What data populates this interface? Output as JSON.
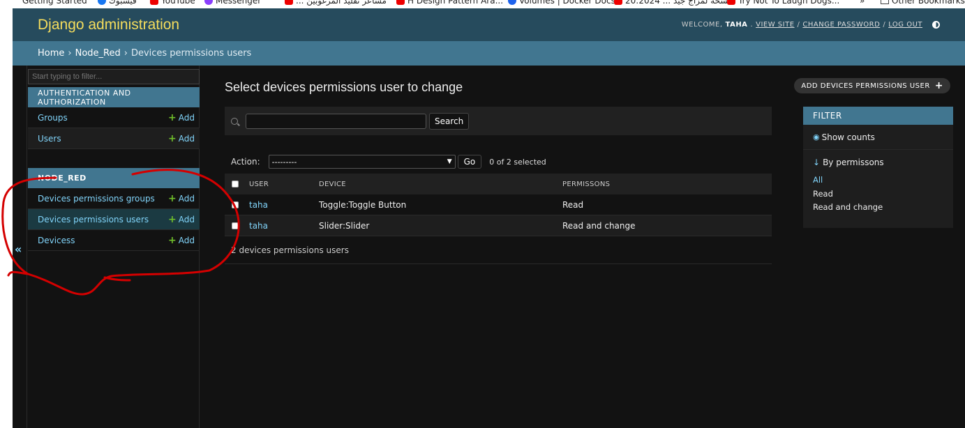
{
  "bookmarks": [
    {
      "label": "Getting Started",
      "icon": "firefox-icon"
    },
    {
      "label": "فيسبوك",
      "icon": "facebook-icon"
    },
    {
      "label": "YouTube",
      "icon": "youtube-icon"
    },
    {
      "label": "Messenger",
      "icon": "messenger-icon"
    },
    {
      "label": "... مشاعر تقليد المرغوبين",
      "icon": "youtube-icon"
    },
    {
      "label": "H Design Pattern Ara...",
      "icon": "youtube-icon"
    },
    {
      "label": "Volumes | Docker Docs",
      "icon": "docker-icon"
    },
    {
      "label": "20:2024 ... نسخة لمزاج جيد",
      "icon": "youtube-icon"
    },
    {
      "label": "Try Not To Laugh Dogs...",
      "icon": "youtube-icon"
    },
    {
      "label": "»",
      "icon": ""
    },
    {
      "label": "Other Bookmarks",
      "icon": "folder-icon"
    }
  ],
  "header": {
    "brand": "Django administration",
    "welcome": "WELCOME,",
    "username": "TAHA",
    "view_site": "VIEW SITE",
    "change_password": "CHANGE PASSWORD",
    "log_out": "LOG OUT",
    "sep": "/"
  },
  "breadcrumbs": {
    "home": "Home",
    "app": "Node_Red",
    "model": "Devices permissions users",
    "sep": "›"
  },
  "sidebar": {
    "filter_placeholder": "Start typing to filter...",
    "collapse": "«",
    "modules": [
      {
        "caption": "AUTHENTICATION AND AUTHORIZATION",
        "rows": [
          {
            "label": "Groups",
            "add": "Add"
          },
          {
            "label": "Users",
            "add": "Add"
          }
        ]
      },
      {
        "caption": "NODE_RED",
        "rows": [
          {
            "label": "Devices permissions groups",
            "add": "Add"
          },
          {
            "label": "Devices permissions users",
            "add": "Add"
          },
          {
            "label": "Devicess",
            "add": "Add"
          }
        ]
      }
    ]
  },
  "main": {
    "title": "Select devices permissions user to change",
    "add_button": "ADD DEVICES PERMISSIONS USER",
    "search_button": "Search",
    "action_label": "Action:",
    "action_value": "---------",
    "go_button": "Go",
    "selected_count": "0 of 2 selected",
    "columns": [
      "USER",
      "DEVICE",
      "PERMISSONS"
    ],
    "rows": [
      {
        "user": "taha",
        "device": "Toggle:Toggle Button",
        "permission": "Read"
      },
      {
        "user": "taha",
        "device": "Slider:Slider",
        "permission": "Read and change"
      }
    ],
    "paginator": "2 devices permissions users"
  },
  "filter": {
    "title": "FILTER",
    "show_counts": "Show counts",
    "section": "By permissons",
    "options": [
      "All",
      "Read",
      "Read and change"
    ]
  },
  "colors": {
    "header": "#264b5d",
    "breadcrumbs": "#417690",
    "brand": "#f5dd5d",
    "link": "#81d4fa",
    "annotation": "#d40000"
  }
}
